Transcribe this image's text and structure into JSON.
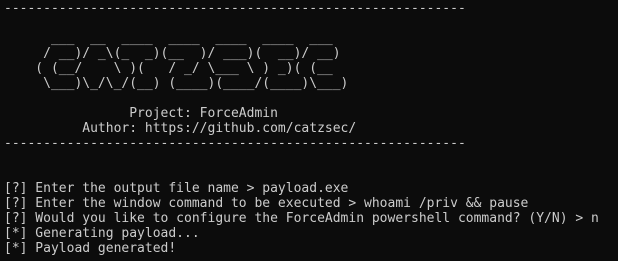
{
  "terminal": {
    "banner_top": "-----------------------------------------------------------",
    "ascii_art": [
      "      ___  __  ____  ____  ____  ____  ___",
      "     / __)/ _\\(_  _)(__  )/ ___)(  __)/ __)",
      "    ( (__/    \\ )(   / _/ \\___ \\ ) _)( (__",
      "     \\___)\\_/\\_/(__) (____)(____/(____)\\___)"
    ],
    "project_line": "                Project: ForceAdmin",
    "author_line": "          Author: https://github.com/catzsec/",
    "banner_bottom": "-----------------------------------------------------------",
    "output_lines": [
      "[?] Enter the output file name > payload.exe",
      "[?] Enter the window command to be executed > whoami /priv && pause",
      "[?] Would you like to configure the ForceAdmin powershell command? (Y/N) > n",
      "[*] Generating payload...",
      "[*] Payload generated!"
    ]
  }
}
